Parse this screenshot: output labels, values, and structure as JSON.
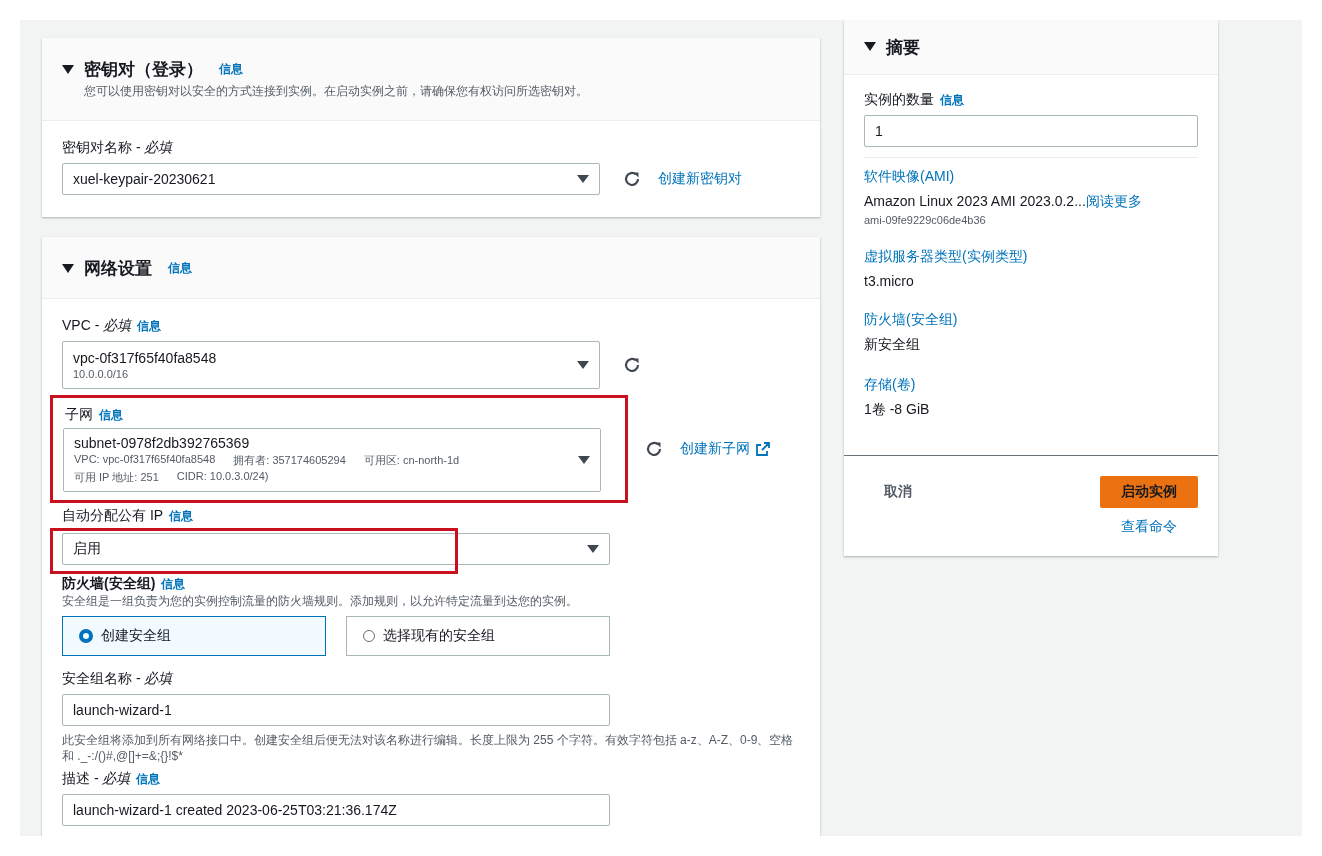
{
  "key_pair": {
    "title": "密钥对（登录）",
    "info": "信息",
    "description": "您可以使用密钥对以安全的方式连接到实例。在启动实例之前，请确保您有权访问所选密钥对。",
    "label": "密钥对名称 - *必填*",
    "value": "xuel-keypair-20230621",
    "create_link": "创建新密钥对"
  },
  "network": {
    "title": "网络设置",
    "info": "信息",
    "vpc": {
      "label": "VPC - *必填*",
      "info": "信息",
      "value": "vpc-0f317f65f40fa8548",
      "detail": "10.0.0.0/16"
    },
    "subnet": {
      "label": "子网",
      "info": "信息",
      "value": "subnet-0978f2db392765369",
      "highlighted": true,
      "create_link": "创建新子网",
      "details": [
        [
          "VPC: vpc-0f317f65f40fa8548",
          "拥有者: 357174605294",
          "可用区: cn-north-1d"
        ],
        [
          "可用 IP 地址: 251",
          "CIDR: 10.0.3.0/24)"
        ]
      ]
    },
    "public_ip": {
      "label": "自动分配公有 IP",
      "info": "信息",
      "value": "启用",
      "highlighted": true
    },
    "firewall": {
      "label": "防火墙(安全组)",
      "info": "信息",
      "description": "安全组是一组负责为您的实例控制流量的防火墙规则。添加规则，以允许特定流量到达您的实例。",
      "options": [
        {
          "label": "创建安全组",
          "selected": true
        },
        {
          "label": "选择现有的安全组",
          "selected": false
        }
      ]
    },
    "sg_name": {
      "label": "安全组名称 - *必填*",
      "value": "launch-wizard-1",
      "hint": "此安全组将添加到所有网络接口中。创建安全组后便无法对该名称进行编辑。长度上限为 255 个字符。有效字符包括 a-z、A-Z、0-9、空格和 ._-:/()#,@[]+=&;{}!$*"
    },
    "sg_description": {
      "label": "描述 - *必填*",
      "info": "信息",
      "value": "launch-wizard-1 created 2023-06-25T03:21:36.174Z"
    }
  },
  "summary": {
    "title": "摘要",
    "count_label": "实例的数量",
    "info": "信息",
    "count_value": "1",
    "items": [
      {
        "label": "软件映像(AMI)",
        "value": "Amazon Linux 2023 AMI 2023.0.2...",
        "link": "阅读更多",
        "sub": "ami-09fe9229c06de4b36"
      },
      {
        "label": "虚拟服务器类型(实例类型)",
        "value": "t3.micro"
      },
      {
        "label": "防火墙(安全组)",
        "value": "新安全组"
      },
      {
        "label": "存储(卷)",
        "value": "1卷 -8 GiB"
      }
    ],
    "cancel": "取消",
    "launch": "启动实例",
    "view_command": "查看命令"
  }
}
